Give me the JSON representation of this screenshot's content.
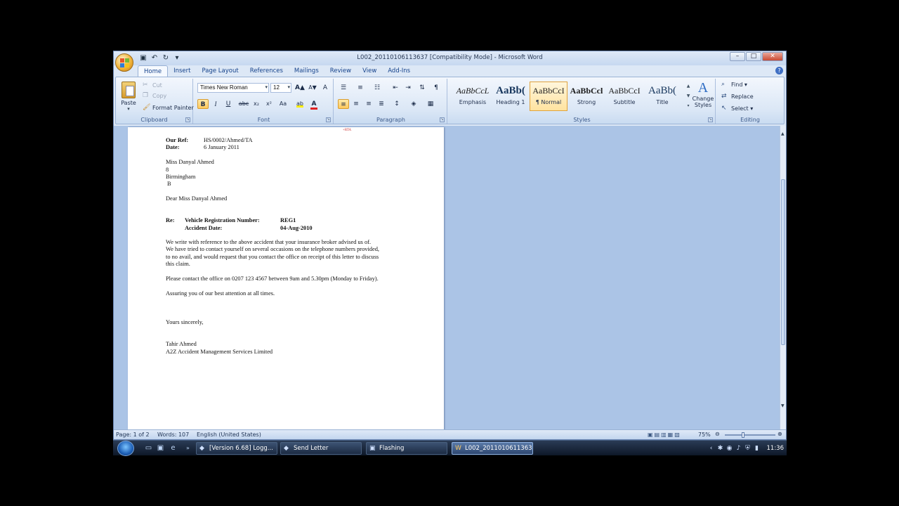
{
  "window": {
    "title": "L002_20110106113637 [Compatibility Mode] - Microsoft Word",
    "controls": {
      "minimize": "–",
      "maximize": "□",
      "close": "✕"
    }
  },
  "tabs": [
    {
      "label": "Home",
      "active": true
    },
    {
      "label": "Insert"
    },
    {
      "label": "Page Layout"
    },
    {
      "label": "References"
    },
    {
      "label": "Mailings"
    },
    {
      "label": "Review"
    },
    {
      "label": "View"
    },
    {
      "label": "Add-Ins"
    }
  ],
  "ribbon": {
    "clipboard": {
      "label": "Clipboard",
      "paste": "Paste",
      "cut": "Cut",
      "copy": "Copy",
      "format_painter": "Format Painter"
    },
    "font": {
      "label": "Font",
      "font_name": "Times New Roman",
      "font_size": "12",
      "bold": "B",
      "italic": "I",
      "underline": "U",
      "strikethrough": "abc",
      "subscript": "x₂",
      "superscript": "x²",
      "change_case": "Aa",
      "grow": "A▲",
      "shrink": "A▼",
      "clear": "A"
    },
    "paragraph": {
      "label": "Paragraph"
    },
    "styles": {
      "label": "Styles",
      "items": [
        {
          "preview": "AaBbCcL",
          "name": "Emphasis"
        },
        {
          "preview": "AaBb(",
          "name": "Heading 1"
        },
        {
          "preview": "AaBbCcI",
          "name": "¶ Normal",
          "selected": true
        },
        {
          "preview": "AaBbCcl",
          "name": "Strong"
        },
        {
          "preview": "AaBbCcI",
          "name": "Subtitle"
        },
        {
          "preview": "AaBb(",
          "name": "Title"
        }
      ],
      "change_styles": "Change Styles"
    },
    "editing": {
      "label": "Editing",
      "find": "Find",
      "replace": "Replace",
      "select": "Select"
    }
  },
  "document": {
    "header_mark": "+RTA",
    "our_ref_label": "Our Ref:",
    "our_ref_value": "HS/0002/Ahmed/TA",
    "date_label": "Date:",
    "date_value": "6 January 2011",
    "address": [
      "Miss Danyal Ahmed",
      "8",
      "Birmingham",
      "B"
    ],
    "salutation": "Dear Miss Danyal Ahmed",
    "re_label": "Re:",
    "vehicle_label": "Vehicle Registration Number:",
    "vehicle_value": "REG1",
    "accident_label": "Accident Date:",
    "accident_value": "04-Aug-2010",
    "paragraph1": [
      "We write with reference to the above accident that your insurance broker   advised us of.",
      "We have tried to contact yourself on several occasions on the telephone numbers provided,",
      "to no avail, and would request that you contact the office on receipt of this letter to discuss",
      "this claim."
    ],
    "paragraph2": "Please contact the office on 0207 123 4567 between 9am and 5.30pm (Monday to Friday).",
    "paragraph3": "Assuring you of our best attention at all times.",
    "closing": "Yours sincerely,",
    "signatory": "Tahir Ahmed",
    "company": "A2Z Accident Management Services Limited"
  },
  "status_bar": {
    "page": "Page: 1 of 2",
    "words": "Words: 107",
    "language": "English (United States)",
    "zoom": "75%",
    "zoom_level": 0.75
  },
  "taskbar": {
    "buttons": [
      {
        "label": "[Version 6.68] Logg..."
      },
      {
        "label": "Send Letter"
      },
      {
        "label": "Flashing"
      },
      {
        "label": "L002_20110106113637...",
        "active": true
      }
    ],
    "clock": "11:36"
  }
}
